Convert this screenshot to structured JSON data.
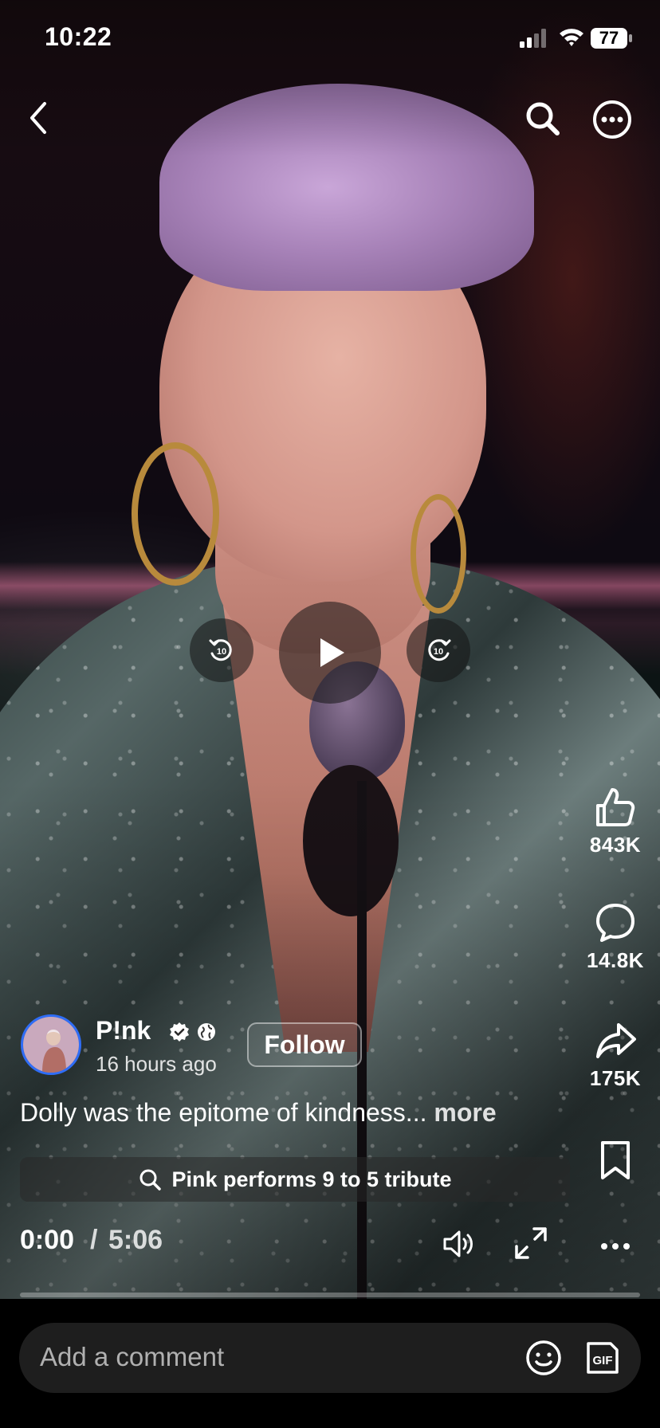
{
  "status_bar": {
    "time": "10:22",
    "battery_level": "77",
    "icons": [
      "signal-icon",
      "wifi-icon",
      "battery-icon"
    ]
  },
  "nav": {
    "icons": [
      "chevron-left-icon",
      "search-icon",
      "more-circle-icon"
    ]
  },
  "player": {
    "controls": [
      "rewind-10-icon",
      "play-icon",
      "forward-10-icon"
    ],
    "rewind_label": "10",
    "forward_label": "10",
    "time_current": "0:00",
    "time_separator": "/",
    "time_total": "5:06",
    "progress": 0.0
  },
  "actions": {
    "likes": "843K",
    "comments": "14.8K",
    "shares": "175K",
    "icons": [
      "thumbs-up-icon",
      "comment-bubble-icon",
      "share-arrow-icon",
      "bookmark-icon",
      "more-dots-icon"
    ]
  },
  "author": {
    "name": "P!nk",
    "time_ago": "16 hours ago",
    "follow_label": "Follow"
  },
  "caption": {
    "text": "Dolly was the epitome of kindness...",
    "more_label": "more"
  },
  "search_suggestion": {
    "text": "Pink performs 9 to 5 tribute"
  },
  "comment_bar": {
    "placeholder": "Add a comment",
    "gif_label": "GIF"
  },
  "colors": {
    "accent_blue": "#2f6df6",
    "comment_bar_bg": "#1e1e1e"
  }
}
